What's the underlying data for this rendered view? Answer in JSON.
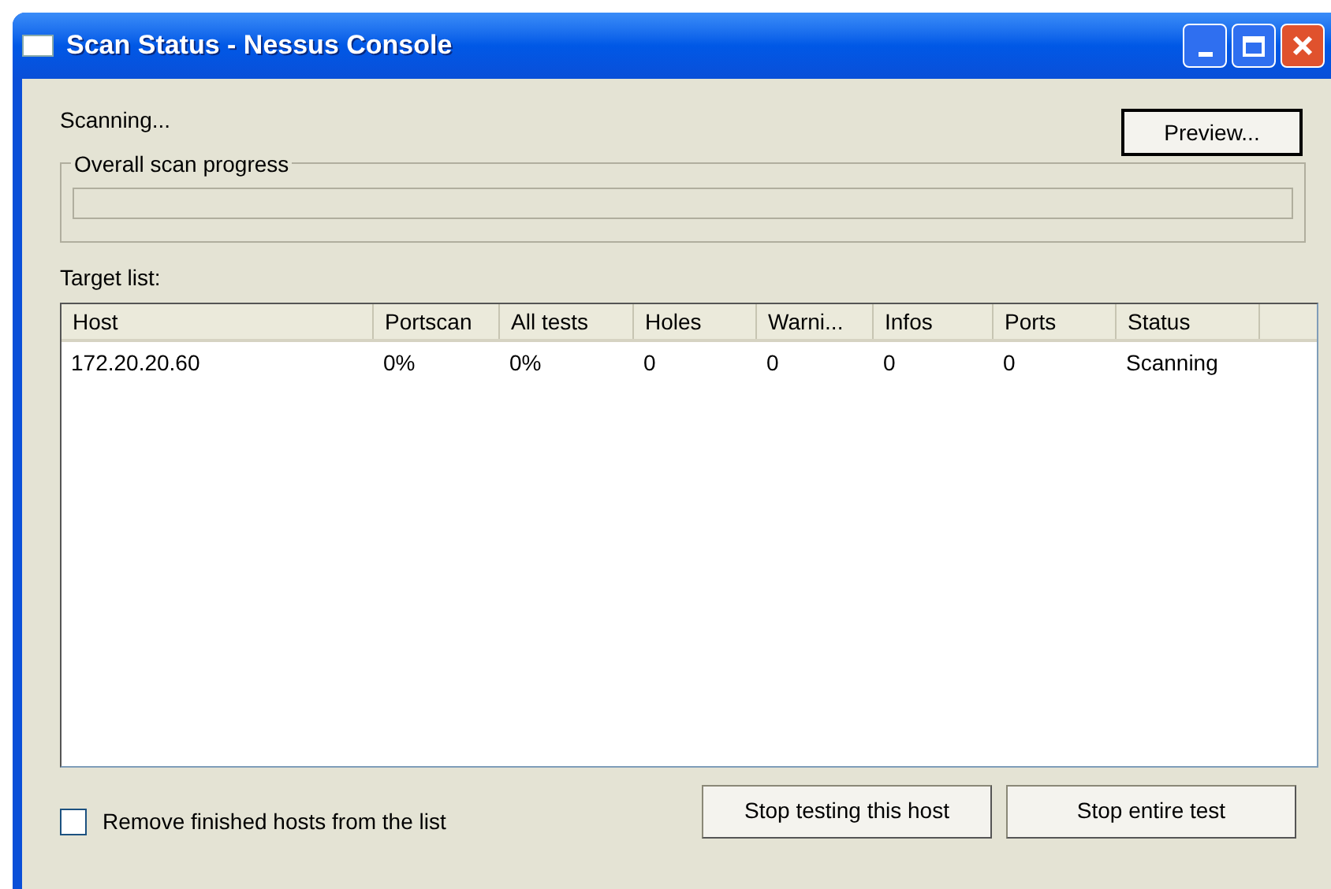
{
  "window": {
    "title": "Scan Status - Nessus Console"
  },
  "status_text": "Scanning...",
  "preview_button": "Preview...",
  "progress_group": {
    "label": "Overall scan progress",
    "level": 0
  },
  "target_list_label": "Target list:",
  "table": {
    "columns": [
      "Host",
      "Portscan",
      "All tests",
      "Holes",
      "Warni...",
      "Infos",
      "Ports",
      "Status"
    ],
    "rows": [
      [
        "172.20.20.60",
        "0%",
        "0%",
        "0",
        "0",
        "0",
        "0",
        "Scanning"
      ]
    ]
  },
  "remove_finished": {
    "label": "Remove finished hosts from the list",
    "checked": false
  },
  "buttons": [
    "Stop testing this host",
    "Stop entire test"
  ]
}
